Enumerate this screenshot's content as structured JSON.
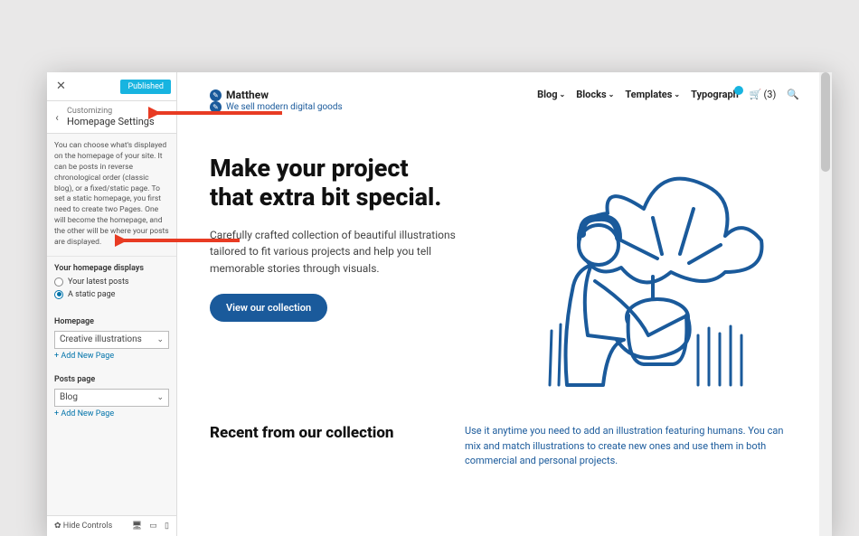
{
  "sidebar": {
    "close": "✕",
    "published": "Published",
    "back": "‹",
    "customizing_label": "Customizing",
    "section_title": "Homepage Settings",
    "description": "You can choose what's displayed on the homepage of your site. It can be posts in reverse chronological order (classic blog), or a fixed/static page. To set a static homepage, you first need to create two Pages. One will become the homepage, and the other will be where your posts are displayed.",
    "displays_label": "Your homepage displays",
    "radio_latest": "Your latest posts",
    "radio_static": "A static page",
    "homepage_label": "Homepage",
    "homepage_value": "Creative illustrations",
    "add_new": "+ Add New Page",
    "posts_label": "Posts page",
    "posts_value": "Blog",
    "hide_controls": "Hide Controls"
  },
  "preview": {
    "site_name": "Matthew",
    "tagline": "We sell modern digital goods",
    "nav": {
      "blog": "Blog",
      "blocks": "Blocks",
      "templates": "Templates",
      "typography": "Typograph",
      "cart": "(3)"
    },
    "hero_h1a": "Make your project",
    "hero_h1b": "that extra bit special.",
    "hero_p": "Carefully crafted collection of beautiful illustrations tailored to fit various projects and help you tell memorable stories through visuals.",
    "cta": "View our collection",
    "recent_h": "Recent from our collection",
    "recent_p": "Use it anytime you need to add an illustration featuring humans. You can mix and match illustrations to create new ones and use them in both commercial and personal projects."
  }
}
